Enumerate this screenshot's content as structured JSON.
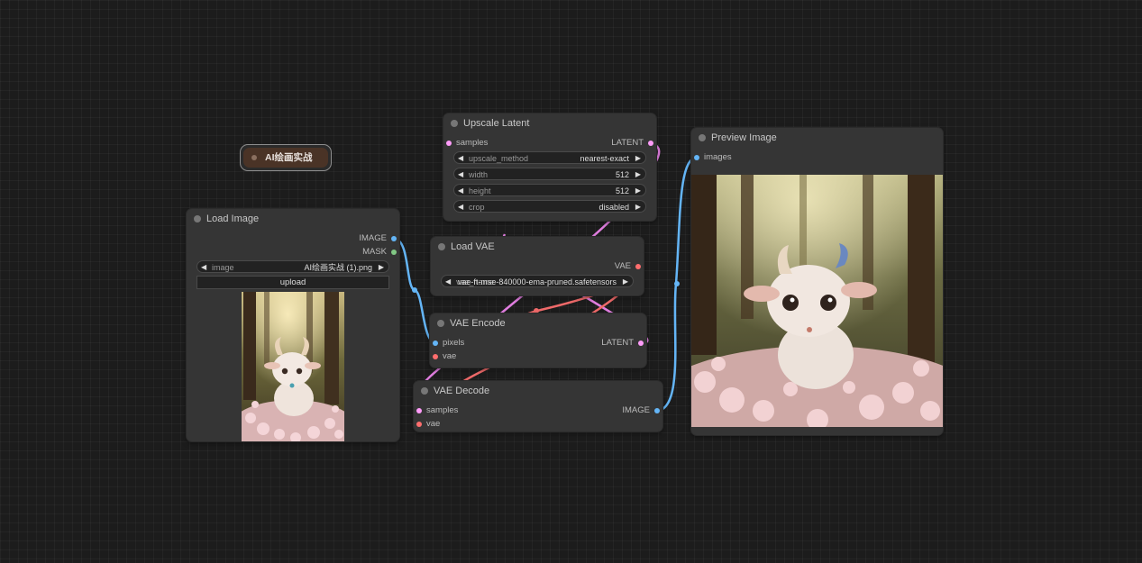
{
  "group": {
    "label": "AI绘画实战"
  },
  "colors": {
    "image": "#64b5f6",
    "mask": "#81c784",
    "latent": "#ff9cf9",
    "vae": "#ff6e6e",
    "link_latent": "#e17ee0",
    "link_vae": "#f06a6a",
    "link_image": "#64b5f6"
  },
  "nodes": {
    "load_image": {
      "title": "Load Image",
      "outputs": {
        "image": "IMAGE",
        "mask": "MASK"
      },
      "widgets": {
        "image_name": "image",
        "image_value": "AI绘画实战 (1).png",
        "upload": "upload"
      }
    },
    "upscale_latent": {
      "title": "Upscale Latent",
      "inputs": {
        "samples": "samples"
      },
      "outputs": {
        "latent": "LATENT"
      },
      "widgets": [
        {
          "name": "upscale_method",
          "value": "nearest-exact"
        },
        {
          "name": "width",
          "value": "512"
        },
        {
          "name": "height",
          "value": "512"
        },
        {
          "name": "crop",
          "value": "disabled"
        }
      ]
    },
    "load_vae": {
      "title": "Load VAE",
      "outputs": {
        "vae": "VAE"
      },
      "widgets": {
        "vae_name": "vae_name",
        "vae_value": "vae-ft-mse-840000-ema-pruned.safetensors"
      }
    },
    "vae_encode": {
      "title": "VAE Encode",
      "inputs": {
        "pixels": "pixels",
        "vae": "vae"
      },
      "outputs": {
        "latent": "LATENT"
      }
    },
    "vae_decode": {
      "title": "VAE Decode",
      "inputs": {
        "samples": "samples",
        "vae": "vae"
      },
      "outputs": {
        "image": "IMAGE"
      }
    },
    "preview_image": {
      "title": "Preview Image",
      "inputs": {
        "images": "images"
      }
    }
  }
}
